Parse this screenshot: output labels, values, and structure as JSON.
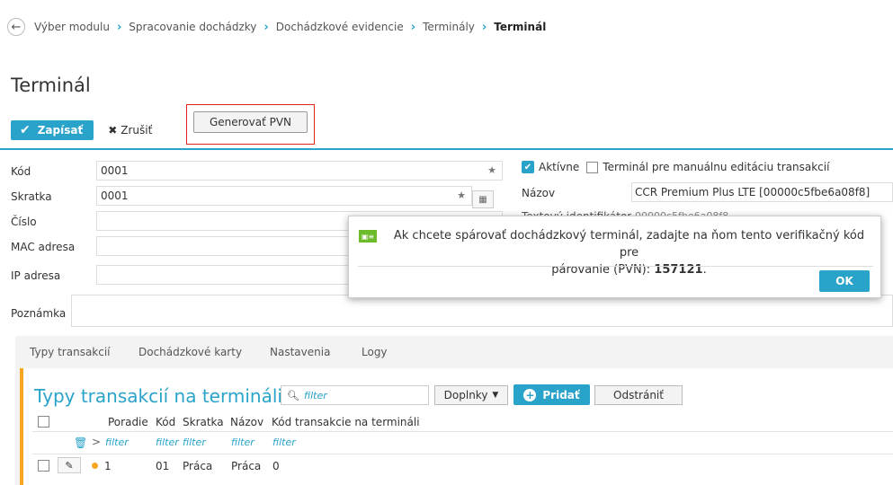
{
  "breadcrumb": {
    "items": [
      "Výber modulu",
      "Spracovanie dochádzky",
      "Dochádzkové evidencie",
      "Terminály"
    ],
    "current": "Terminál"
  },
  "page_title": "Terminál",
  "toolbar": {
    "save_label": "Zapísať",
    "cancel_label": "Zrušiť",
    "generate_label": "Generovať PVN"
  },
  "form": {
    "kod_label": "Kód",
    "kod_value": "0001",
    "skratka_label": "Skratka",
    "skratka_value": "0001",
    "cislo_label": "Číslo",
    "mac_label": "MAC adresa",
    "ip_label": "IP adresa",
    "poznamka_label": "Poznámka",
    "aktivne_label": "Aktívne",
    "manual_label": "Terminál pre manuálnu editáciu transakcií",
    "nazov_label": "Názov",
    "nazov_value": "CCR Premium Plus LTE [00000c5fbe6a08f8]",
    "textovy_label": "Textový identifikátor",
    "textovy_value": "00000c5fbe6a08f8"
  },
  "dialog": {
    "message": "Ak chcete spárovať dochádzkový terminál, zadajte na ňom tento verifikačný kód pre",
    "message_line2": "párovanie (PVN):",
    "code": "157121",
    "ok_label": "OK"
  },
  "tabs": [
    "Typy transakcií",
    "Dochádzkové karty",
    "Nastavenia",
    "Logy"
  ],
  "panel": {
    "title": "Typy transakcií na termináli",
    "filter_placeholder": "filter",
    "doplnky_label": "Doplnky",
    "pridat_label": "Pridať",
    "odstranit_label": "Odstrániť"
  },
  "table": {
    "columns": [
      "Poradie",
      "Kód",
      "Skratka",
      "Názov",
      "Kód transakcie na termináli"
    ],
    "filter_placeholder": "filter",
    "rows": [
      {
        "poradie": "1",
        "kod": "01",
        "skratka": "Práca",
        "nazov": "Práca",
        "kod_transakcie": "0"
      }
    ]
  },
  "colors": {
    "accent": "#29a3c9",
    "highlight": "#e0241b",
    "panel_border": "#f5a623",
    "info_icon": "#6cbb2a"
  }
}
